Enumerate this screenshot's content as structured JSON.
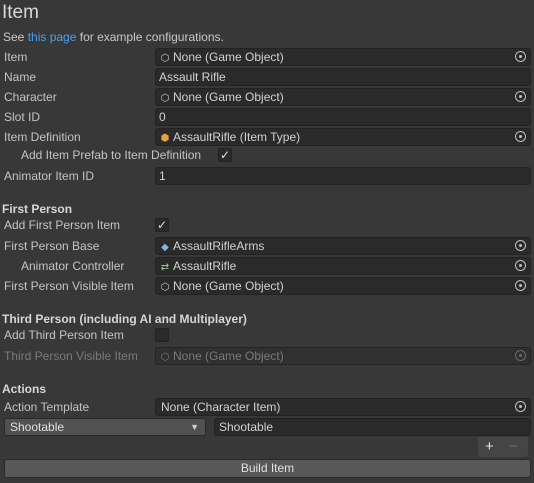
{
  "header": {
    "title": "Item",
    "see_prefix": "See",
    "see_link": "this page",
    "see_suffix": "for example configurations."
  },
  "fields": {
    "item": {
      "label": "Item",
      "value": "None (Game Object)",
      "icon": "cube-icon"
    },
    "name": {
      "label": "Name",
      "value": "Assault Rifle"
    },
    "character": {
      "label": "Character",
      "value": "None (Game Object)",
      "icon": "cube-icon"
    },
    "slot_id": {
      "label": "Slot ID",
      "value": "0"
    },
    "item_definition": {
      "label": "Item Definition",
      "value": "AssaultRifle (Item Type)",
      "icon": "item-type-icon"
    },
    "add_prefab": {
      "label": "Add Item Prefab to Item Definition",
      "checked": true
    },
    "animator_item_id": {
      "label": "Animator Item ID",
      "value": "1"
    }
  },
  "first_person": {
    "section_title": "First Person",
    "add_item": {
      "label": "Add First Person Item",
      "checked": true
    },
    "base": {
      "label": "First Person Base",
      "value": "AssaultRifleArms",
      "icon": "prefab-icon"
    },
    "animator_controller": {
      "label": "Animator Controller",
      "value": "AssaultRifle",
      "icon": "animator-icon"
    },
    "visible_item": {
      "label": "First Person Visible Item",
      "value": "None (Game Object)",
      "icon": "cube-icon"
    }
  },
  "third_person": {
    "section_title": "Third Person (including AI and Multiplayer)",
    "add_item": {
      "label": "Add Third Person Item",
      "checked": false
    },
    "visible_item": {
      "label": "Third Person Visible Item",
      "value": "None (Game Object)",
      "icon": "cube-icon"
    }
  },
  "actions": {
    "section_title": "Actions",
    "template": {
      "label": "Action Template",
      "value": "None (Character Item)"
    },
    "type_dropdown": "Shootable",
    "action_name": "Shootable",
    "add_symbol": "+",
    "remove_symbol": "−",
    "build_button": "Build Item"
  }
}
